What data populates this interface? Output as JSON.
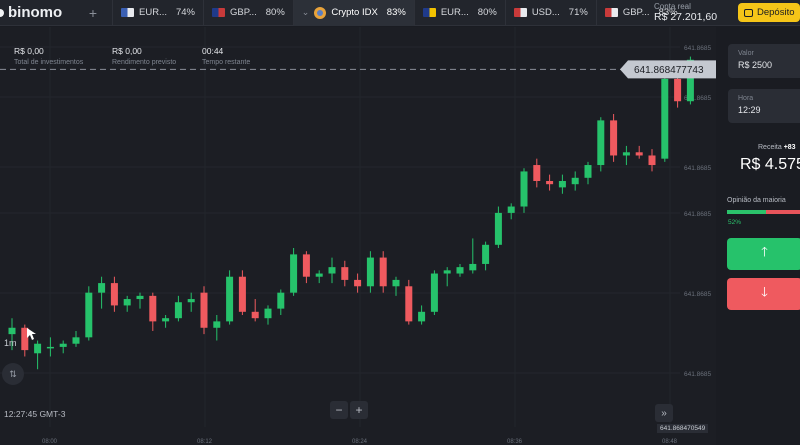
{
  "app": {
    "logo": "binomo"
  },
  "tabs": [
    {
      "name": "EUR...",
      "pct": "74%",
      "flag_a": "#3a5fb3",
      "flag_b": "#e8eaee"
    },
    {
      "name": "GBP...",
      "pct": "80%",
      "flag_a": "#1f3a8a",
      "flag_b": "#c83a3a"
    },
    {
      "name": "Crypto IDX",
      "pct": "83%",
      "active": true
    },
    {
      "name": "EUR...",
      "pct": "80%",
      "flag_a": "#1f3a8a",
      "flag_b": "#f2c200"
    },
    {
      "name": "USD...",
      "pct": "71%",
      "flag_a": "#c83a3a",
      "flag_b": "#e8eaee"
    },
    {
      "name": "GBP...",
      "pct": "83%",
      "flag_a": "#c83a3a",
      "flag_b": "#e8eaee"
    }
  ],
  "account": {
    "label": "Conta real",
    "balance": "R$ 27.201,60"
  },
  "deposit": {
    "label": "Depósito"
  },
  "stats": [
    {
      "value": "R$ 0,00",
      "label": "Total de investimentos"
    },
    {
      "value": "R$ 0,00",
      "label": "Rendimento previsto"
    },
    {
      "value": "00:44",
      "label": "Tempo restante"
    }
  ],
  "current_price": "641.868477743",
  "price_labels": [
    "641.8685",
    "641.8685",
    "641.8685",
    "641.8685",
    "641.8685",
    "641.8685"
  ],
  "bottom_price": "641.868470549",
  "timeframe": "1m",
  "clock": "12:27:45 GMT-3",
  "time_labels": [
    "08:00",
    "08:12",
    "08:24",
    "08:36",
    "08:48"
  ],
  "zoom": {
    "minus": "−",
    "plus": "+"
  },
  "panel": {
    "valor_label": "Valor",
    "valor": "R$ 2500",
    "hora_label": "Hora",
    "hora": "12:29",
    "receita_label": "Receita",
    "receita_pct": "+83",
    "receita_value": "R$ 4.575",
    "opiniao_label": "Opinião da maioria",
    "opiniao_pct": "52%",
    "opiniao_green": 0.52
  },
  "colors": {
    "up": "#26c26b",
    "down": "#ef5a5f",
    "accent": "#f5c518"
  },
  "candles": [
    {
      "o": 641.8679,
      "h": 641.86795,
      "l": 641.86785,
      "c": 641.86792
    },
    {
      "o": 641.86792,
      "h": 641.86793,
      "l": 641.86783,
      "c": 641.86785
    },
    {
      "o": 641.86784,
      "h": 641.86788,
      "l": 641.86779,
      "c": 641.86787
    },
    {
      "o": 641.86786,
      "h": 641.86789,
      "l": 641.86783,
      "c": 641.86786
    },
    {
      "o": 641.86786,
      "h": 641.86788,
      "l": 641.86784,
      "c": 641.86787
    },
    {
      "o": 641.86787,
      "h": 641.86791,
      "l": 641.86786,
      "c": 641.86789
    },
    {
      "o": 641.86789,
      "h": 641.86805,
      "l": 641.86788,
      "c": 641.86803
    },
    {
      "o": 641.86803,
      "h": 641.86808,
      "l": 641.86798,
      "c": 641.86806
    },
    {
      "o": 641.86806,
      "h": 641.86808,
      "l": 641.86797,
      "c": 641.86799
    },
    {
      "o": 641.86799,
      "h": 641.86802,
      "l": 641.86797,
      "c": 641.86801
    },
    {
      "o": 641.86801,
      "h": 641.86803,
      "l": 641.86798,
      "c": 641.86802
    },
    {
      "o": 641.86802,
      "h": 641.86803,
      "l": 641.86791,
      "c": 641.86794
    },
    {
      "o": 641.86794,
      "h": 641.86796,
      "l": 641.86792,
      "c": 641.86795
    },
    {
      "o": 641.86795,
      "h": 641.86802,
      "l": 641.86794,
      "c": 641.868
    },
    {
      "o": 641.868,
      "h": 641.86803,
      "l": 641.86797,
      "c": 641.86801
    },
    {
      "o": 641.86803,
      "h": 641.86805,
      "l": 641.8679,
      "c": 641.86792
    },
    {
      "o": 641.86792,
      "h": 641.86796,
      "l": 641.86788,
      "c": 641.86794
    },
    {
      "o": 641.86794,
      "h": 641.8681,
      "l": 641.86793,
      "c": 641.86808
    },
    {
      "o": 641.86808,
      "h": 641.8681,
      "l": 641.86796,
      "c": 641.86797
    },
    {
      "o": 641.86797,
      "h": 641.86801,
      "l": 641.86794,
      "c": 641.86795
    },
    {
      "o": 641.86795,
      "h": 641.86799,
      "l": 641.86793,
      "c": 641.86798
    },
    {
      "o": 641.86798,
      "h": 641.86804,
      "l": 641.86796,
      "c": 641.86803
    },
    {
      "o": 641.86803,
      "h": 641.86817,
      "l": 641.86802,
      "c": 641.86815
    },
    {
      "o": 641.86815,
      "h": 641.86816,
      "l": 641.86806,
      "c": 641.86808
    },
    {
      "o": 641.86808,
      "h": 641.8681,
      "l": 641.86806,
      "c": 641.86809
    },
    {
      "o": 641.86809,
      "h": 641.86814,
      "l": 641.86806,
      "c": 641.86811
    },
    {
      "o": 641.86811,
      "h": 641.86813,
      "l": 641.86805,
      "c": 641.86807
    },
    {
      "o": 641.86807,
      "h": 641.86809,
      "l": 641.86803,
      "c": 641.86805
    },
    {
      "o": 641.86805,
      "h": 641.86816,
      "l": 641.86803,
      "c": 641.86814
    },
    {
      "o": 641.86814,
      "h": 641.86816,
      "l": 641.86803,
      "c": 641.86805
    },
    {
      "o": 641.86805,
      "h": 641.86808,
      "l": 641.86802,
      "c": 641.86807
    },
    {
      "o": 641.86805,
      "h": 641.86807,
      "l": 641.86793,
      "c": 641.86794
    },
    {
      "o": 641.86794,
      "h": 641.86799,
      "l": 641.86793,
      "c": 641.86797
    },
    {
      "o": 641.86797,
      "h": 641.8681,
      "l": 641.86796,
      "c": 641.86809
    },
    {
      "o": 641.86809,
      "h": 641.86811,
      "l": 641.86805,
      "c": 641.8681
    },
    {
      "o": 641.86809,
      "h": 641.86812,
      "l": 641.86808,
      "c": 641.86811
    },
    {
      "o": 641.8681,
      "h": 641.8682,
      "l": 641.86809,
      "c": 641.86812
    },
    {
      "o": 641.86812,
      "h": 641.86819,
      "l": 641.8681,
      "c": 641.86818
    },
    {
      "o": 641.86818,
      "h": 641.8683,
      "l": 641.86817,
      "c": 641.86828
    },
    {
      "o": 641.86828,
      "h": 641.86831,
      "l": 641.86826,
      "c": 641.8683
    },
    {
      "o": 641.8683,
      "h": 641.86842,
      "l": 641.86828,
      "c": 641.86841
    },
    {
      "o": 641.86843,
      "h": 641.86845,
      "l": 641.86836,
      "c": 641.86838
    },
    {
      "o": 641.86838,
      "h": 641.8684,
      "l": 641.86835,
      "c": 641.86837
    },
    {
      "o": 641.86836,
      "h": 641.8684,
      "l": 641.86834,
      "c": 641.86838
    },
    {
      "o": 641.86837,
      "h": 641.86841,
      "l": 641.86835,
      "c": 641.86839
    },
    {
      "o": 641.86839,
      "h": 641.86844,
      "l": 641.86837,
      "c": 641.86843
    },
    {
      "o": 641.86843,
      "h": 641.86858,
      "l": 641.86841,
      "c": 641.86857
    },
    {
      "o": 641.86857,
      "h": 641.86859,
      "l": 641.86844,
      "c": 641.86846
    },
    {
      "o": 641.86846,
      "h": 641.86849,
      "l": 641.86843,
      "c": 641.86847
    },
    {
      "o": 641.86847,
      "h": 641.86849,
      "l": 641.86845,
      "c": 641.86846
    },
    {
      "o": 641.86846,
      "h": 641.86848,
      "l": 641.86841,
      "c": 641.86843
    },
    {
      "o": 641.86845,
      "h": 641.86871,
      "l": 641.86844,
      "c": 641.8687
    },
    {
      "o": 641.8687,
      "h": 641.86872,
      "l": 641.86861,
      "c": 641.86863
    },
    {
      "o": 641.86863,
      "h": 641.86877,
      "l": 641.86862,
      "c": 641.86876
    }
  ]
}
